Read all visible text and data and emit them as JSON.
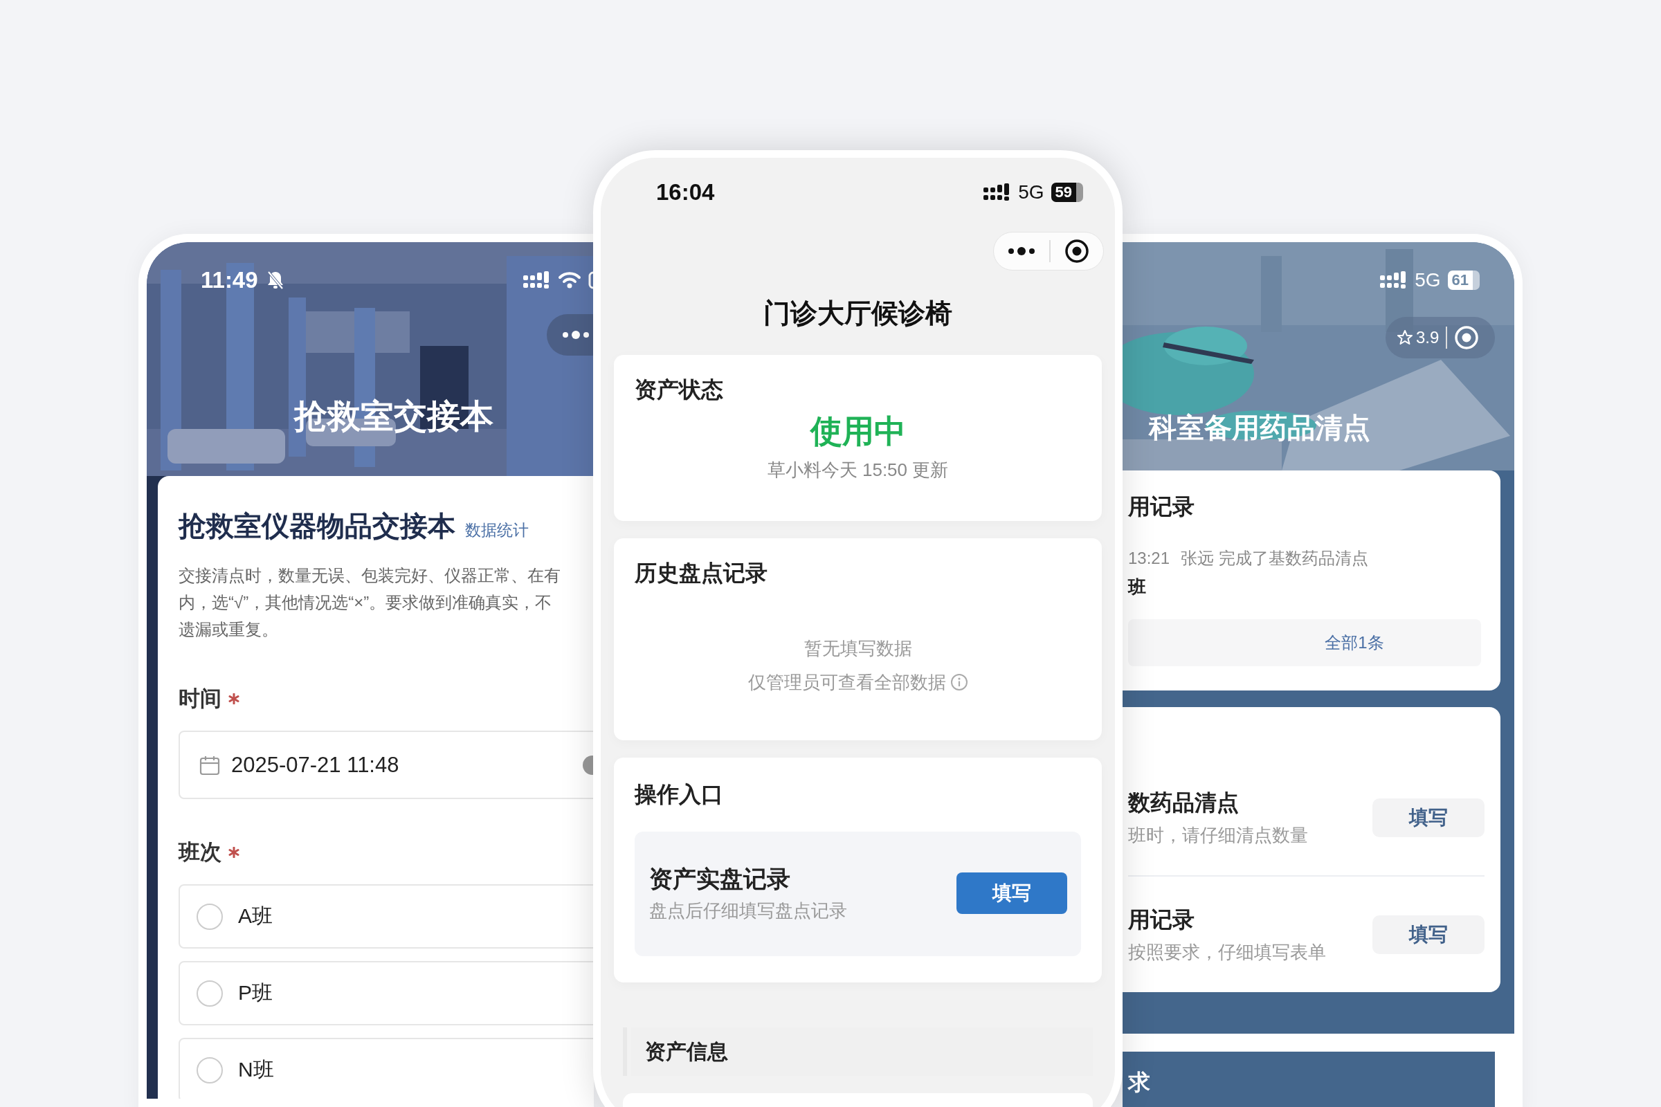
{
  "left_phone": {
    "status_bar": {
      "time": "11:49",
      "muted": true
    },
    "header": {
      "title": "抢救室交接本"
    },
    "form": {
      "title": "抢救室仪器物品交接本",
      "stats_link": "数据统计",
      "description_lines": [
        "交接清点时，数量无误、包装完好、仪器正常、在有",
        "内，选“√”，其他情况选“×”。要求做到准确真实，不",
        "遗漏或重复。"
      ],
      "fields": [
        {
          "kind": "datetime",
          "label": "时间",
          "required": true,
          "value": "2025-07-21 11:48"
        },
        {
          "kind": "radio",
          "label": "班次",
          "required": true,
          "options": [
            {
              "label": "A班",
              "selected": false
            },
            {
              "label": "P班",
              "selected": false
            },
            {
              "label": "N班",
              "selected": false
            }
          ]
        }
      ]
    }
  },
  "center_phone": {
    "status_bar": {
      "time": "16:04",
      "network": "5G",
      "battery": "59"
    },
    "title": "门诊大厅候诊椅",
    "asset_status": {
      "title": "资产状态",
      "status": "使用中",
      "updated": "草小料今天 15:50 更新"
    },
    "history": {
      "title": "历史盘点记录",
      "empty_text": "暂无填写数据",
      "note": "仅管理员可查看全部数据"
    },
    "actions": {
      "title": "操作入口",
      "entries": [
        {
          "title": "资产实盘记录",
          "subtitle": "盘点后仔细填写盘点记录",
          "button": "填写"
        }
      ]
    },
    "sections": [
      {
        "title": "资产信息"
      }
    ]
  },
  "right_phone": {
    "status_bar": {
      "network": "5G",
      "battery": "61"
    },
    "rating": "3.9",
    "header": {
      "title": "科室备用药品清点"
    },
    "records": {
      "title": "用记录",
      "entries": [
        {
          "time": "13:21",
          "text": "张远 完成了基数药品清点",
          "shift": "班"
        }
      ],
      "more_button": "全部1条"
    },
    "forms": [
      {
        "title": "数药品清点",
        "subtitle": "班时，请仔细清点数量",
        "button": "填写"
      },
      {
        "title": "用记录",
        "subtitle": "按照要求，仔细填写表单",
        "button": "填写"
      }
    ],
    "section": {
      "title": "求"
    }
  }
}
